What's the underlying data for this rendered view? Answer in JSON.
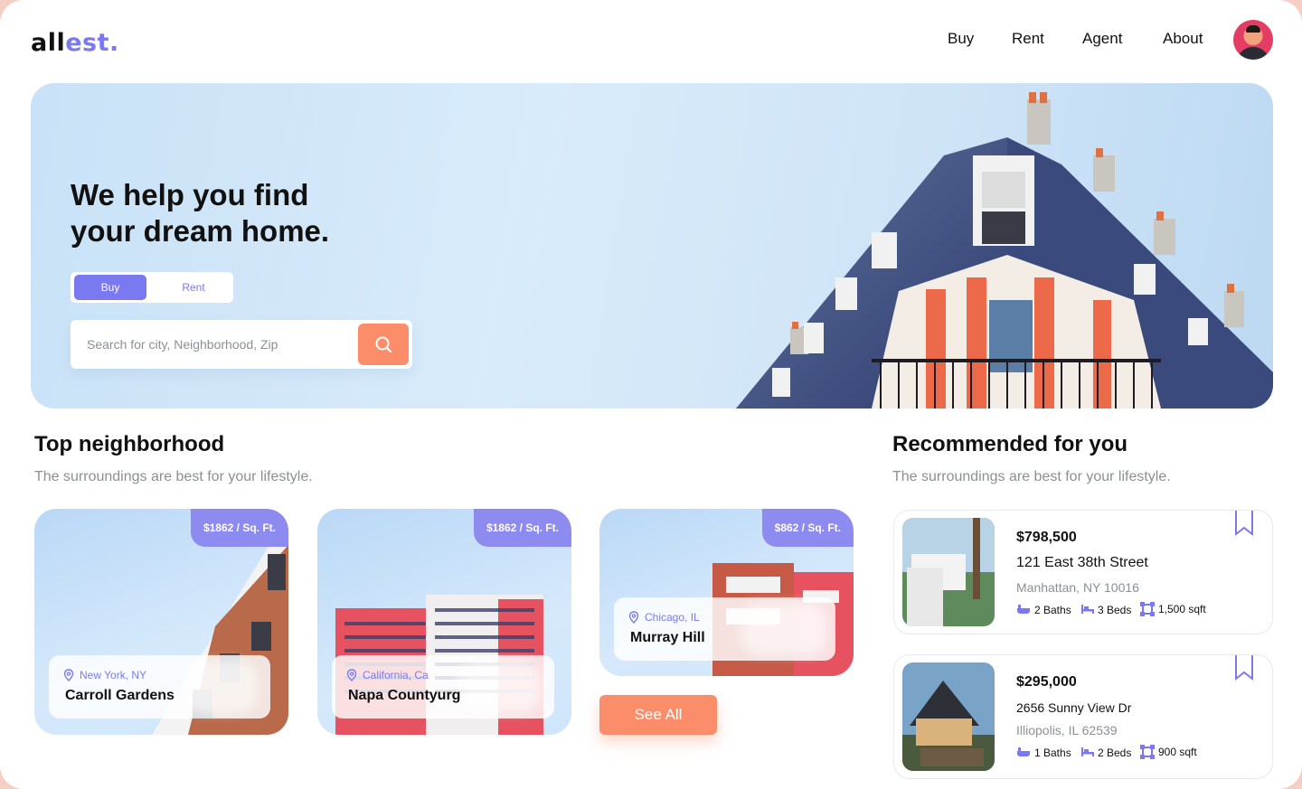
{
  "brand": {
    "logo_part1": "all",
    "logo_part2": "est."
  },
  "nav": {
    "items": [
      "Buy",
      "Rent",
      "Agent",
      "About"
    ]
  },
  "hero": {
    "title_line1": "We help you find",
    "title_line2": "your dream home.",
    "toggle": {
      "buy": "Buy",
      "rent": "Rent",
      "active": "Buy"
    },
    "search": {
      "placeholder": "Search for city, Neighborhood, Zip",
      "value": ""
    }
  },
  "top_neighborhood": {
    "title": "Top neighborhood",
    "subtitle": "The surroundings are best for your lifestyle.",
    "cards": [
      {
        "price": "$1862 / Sq. Ft.",
        "city": "New York, NY",
        "name": "Carroll Gardens"
      },
      {
        "price": "$1862 / Sq. Ft.",
        "city": "California, Ca",
        "name": "Napa Countyurg"
      },
      {
        "price": "$862 / Sq. Ft.",
        "city": "Chicago, IL",
        "name": "Murray Hill"
      }
    ],
    "see_all": "See All"
  },
  "recommended": {
    "title": "Recommended for you",
    "subtitle": "The surroundings are best for your lifestyle.",
    "listings": [
      {
        "price": "$798,500",
        "street": "121 East 38th Street",
        "city": "Manhattan, NY 10016",
        "baths": "2 Baths",
        "beds": "3 Beds",
        "area": "1,500 sqft"
      },
      {
        "price": "$295,000",
        "street": "2656 Sunny View Dr",
        "city": "Illiopolis, IL 62539",
        "baths": "1 Baths",
        "beds": "2 Beds",
        "area": "900 sqft"
      }
    ]
  },
  "colors": {
    "accent": "#7b79f0",
    "cta": "#fb8d6a",
    "page_bg": "#f6cfc4"
  },
  "icons": [
    "search-icon",
    "location-pin-icon",
    "bathtub-icon",
    "bed-icon",
    "area-icon",
    "bookmark-icon"
  ]
}
